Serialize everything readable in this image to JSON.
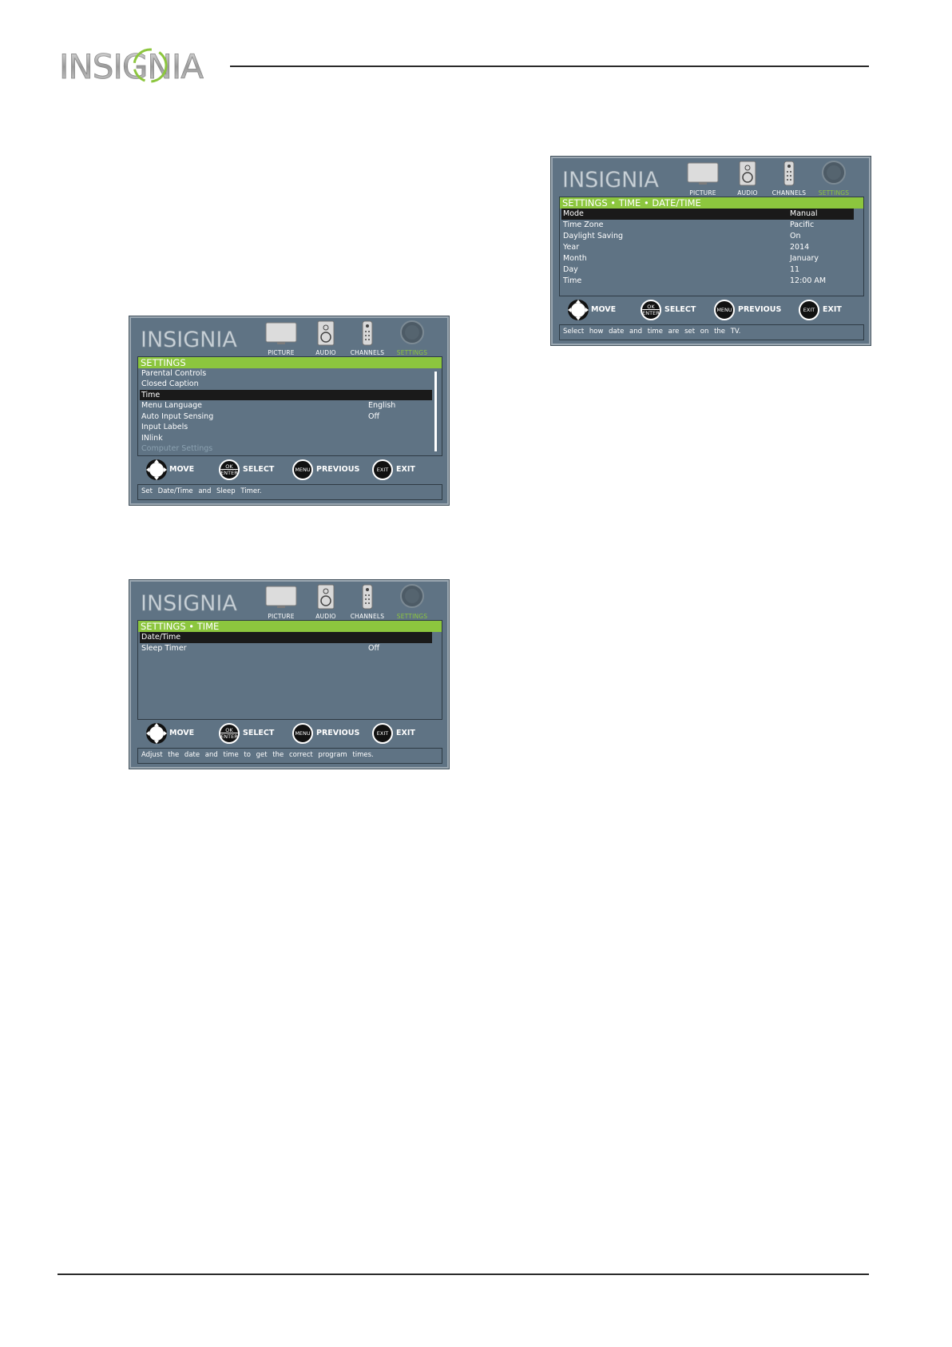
{
  "brand": {
    "logo_text": "INSIGNIA"
  },
  "screens": [
    {
      "tabs": [
        "PICTURE",
        "AUDIO",
        "CHANNELS",
        "SETTINGS"
      ],
      "title": "SETTINGS",
      "rows": [
        {
          "label": "Parental Controls",
          "value": ""
        },
        {
          "label": "Closed Caption",
          "value": ""
        },
        {
          "label": "Time",
          "value": ""
        },
        {
          "label": "Menu Language",
          "value": "English"
        },
        {
          "label": "Auto Input Sensing",
          "value": "Off"
        },
        {
          "label": "Input Labels",
          "value": ""
        },
        {
          "label": "INlink",
          "value": ""
        },
        {
          "label": "Computer Settings",
          "value": ""
        }
      ],
      "controls": [
        "MOVE",
        "SELECT",
        "PREVIOUS",
        "EXIT"
      ],
      "help": "Set Date/Time and Sleep Timer."
    },
    {
      "tabs": [
        "PICTURE",
        "AUDIO",
        "CHANNELS",
        "SETTINGS"
      ],
      "title": "SETTINGS • TIME",
      "rows": [
        {
          "label": "Date/Time",
          "value": ""
        },
        {
          "label": "Sleep Timer",
          "value": "Off"
        }
      ],
      "controls": [
        "MOVE",
        "SELECT",
        "PREVIOUS",
        "EXIT"
      ],
      "help": "Adjust the date and time to get the correct program times."
    },
    {
      "tabs": [
        "PICTURE",
        "AUDIO",
        "CHANNELS",
        "SETTINGS"
      ],
      "title": "SETTINGS • TIME • DATE/TIME",
      "rows": [
        {
          "label": "Mode",
          "value": "Manual"
        },
        {
          "label": "Time Zone",
          "value": "Pacific"
        },
        {
          "label": "Daylight Saving",
          "value": "On"
        },
        {
          "label": "Year",
          "value": "2014"
        },
        {
          "label": "Month",
          "value": "January"
        },
        {
          "label": "Day",
          "value": "11"
        },
        {
          "label": "Time",
          "value": "12:00 AM"
        }
      ],
      "controls": [
        "MOVE",
        "SELECT",
        "PREVIOUS",
        "EXIT"
      ],
      "help": "Select how date and time are set on the TV."
    }
  ],
  "buttons": {
    "ok": "OK",
    "enter": "ENTER",
    "menu": "MENU",
    "exit": "EXIT"
  }
}
